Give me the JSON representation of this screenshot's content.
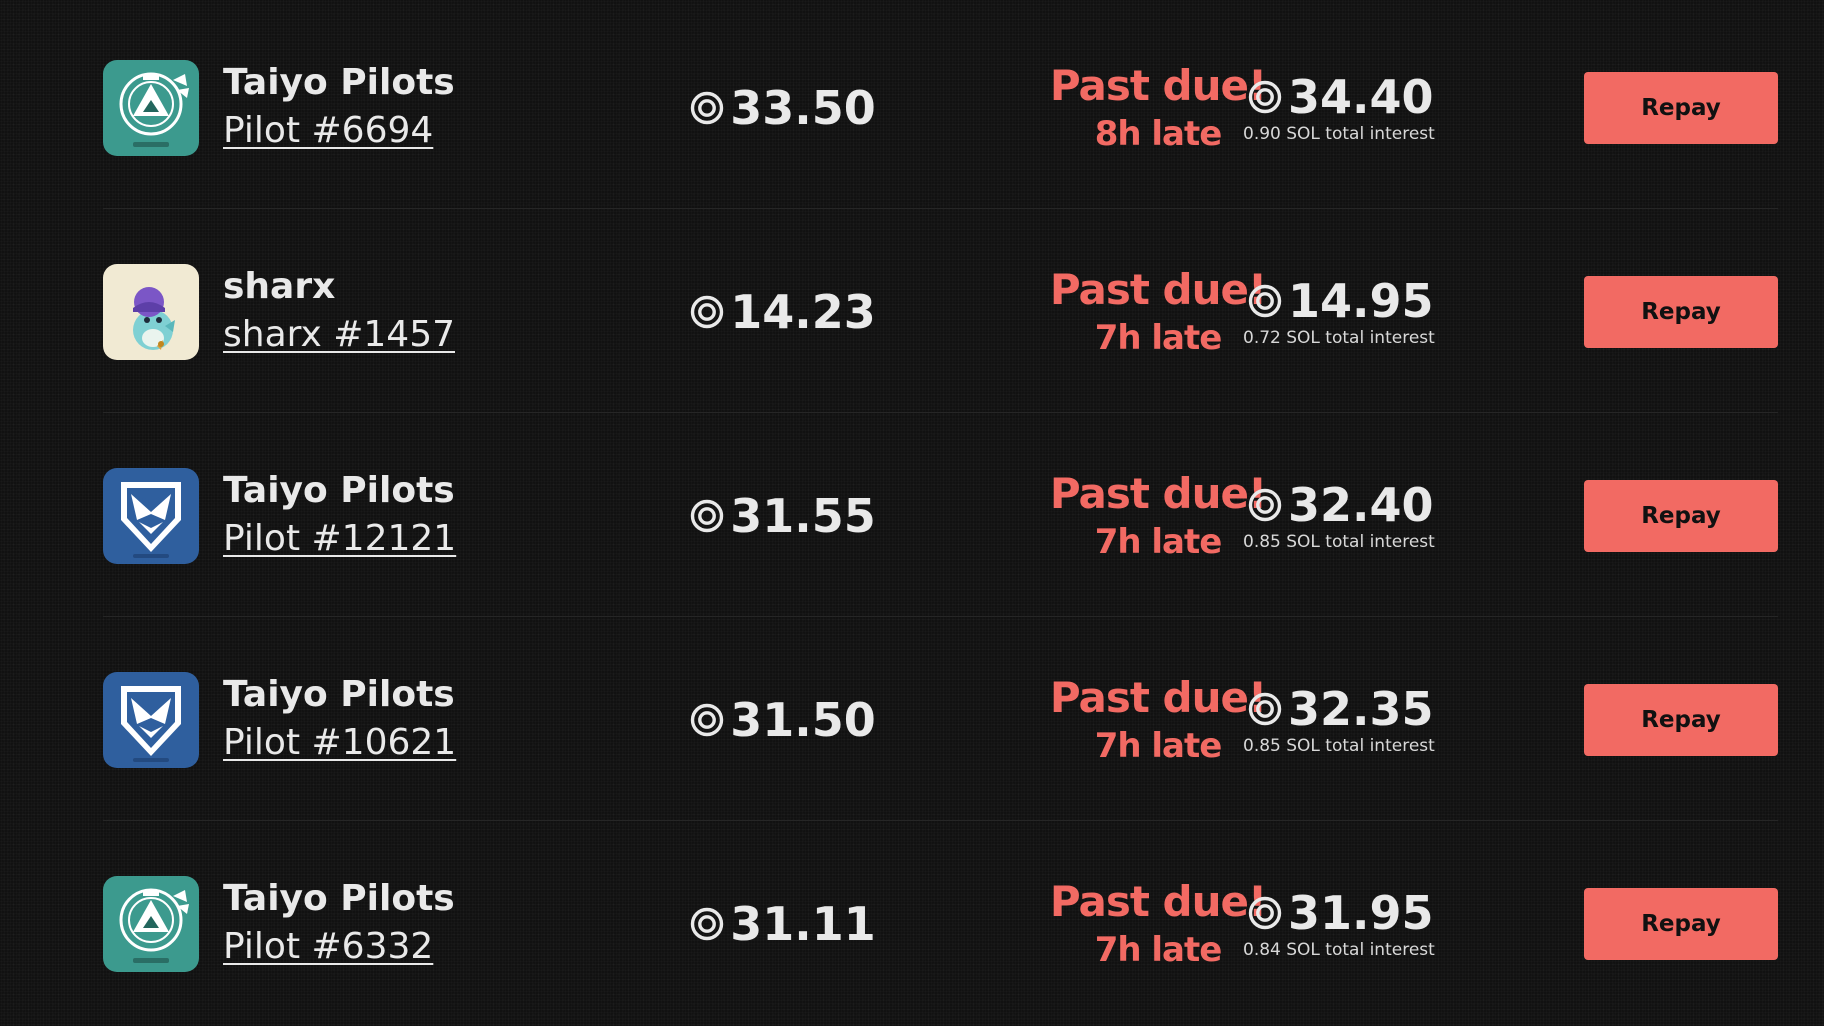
{
  "colors": {
    "background": "#111111",
    "accent": "#f26a63",
    "text": "#e9e9e9",
    "divider": "#262626"
  },
  "loans": [
    {
      "collection": "Taiyo Pilots",
      "nft_name": "Pilot #6694",
      "avatar": "taiyo-operator-badge",
      "amount": "33.50",
      "status": "Past due!",
      "late": "8h late",
      "repay_amount": "34.40",
      "interest": "0.90 SOL total interest",
      "button": "Repay"
    },
    {
      "collection": "sharx",
      "nft_name": "sharx #1457",
      "avatar": "sharx-shark-character",
      "amount": "14.23",
      "status": "Past due!",
      "late": "7h late",
      "repay_amount": "14.95",
      "interest": "0.72 SOL total interest",
      "button": "Repay"
    },
    {
      "collection": "Taiyo Pilots",
      "nft_name": "Pilot #12121",
      "avatar": "taiyo-enforcer-badge",
      "amount": "31.55",
      "status": "Past due!",
      "late": "7h late",
      "repay_amount": "32.40",
      "interest": "0.85 SOL total interest",
      "button": "Repay"
    },
    {
      "collection": "Taiyo Pilots",
      "nft_name": "Pilot #10621",
      "avatar": "taiyo-enforcer-badge",
      "amount": "31.50",
      "status": "Past due!",
      "late": "7h late",
      "repay_amount": "32.35",
      "interest": "0.85 SOL total interest",
      "button": "Repay"
    },
    {
      "collection": "Taiyo Pilots",
      "nft_name": "Pilot #6332",
      "avatar": "taiyo-operator-badge",
      "amount": "31.11",
      "status": "Past due!",
      "late": "7h late",
      "repay_amount": "31.95",
      "interest": "0.84 SOL total interest",
      "button": "Repay"
    }
  ]
}
